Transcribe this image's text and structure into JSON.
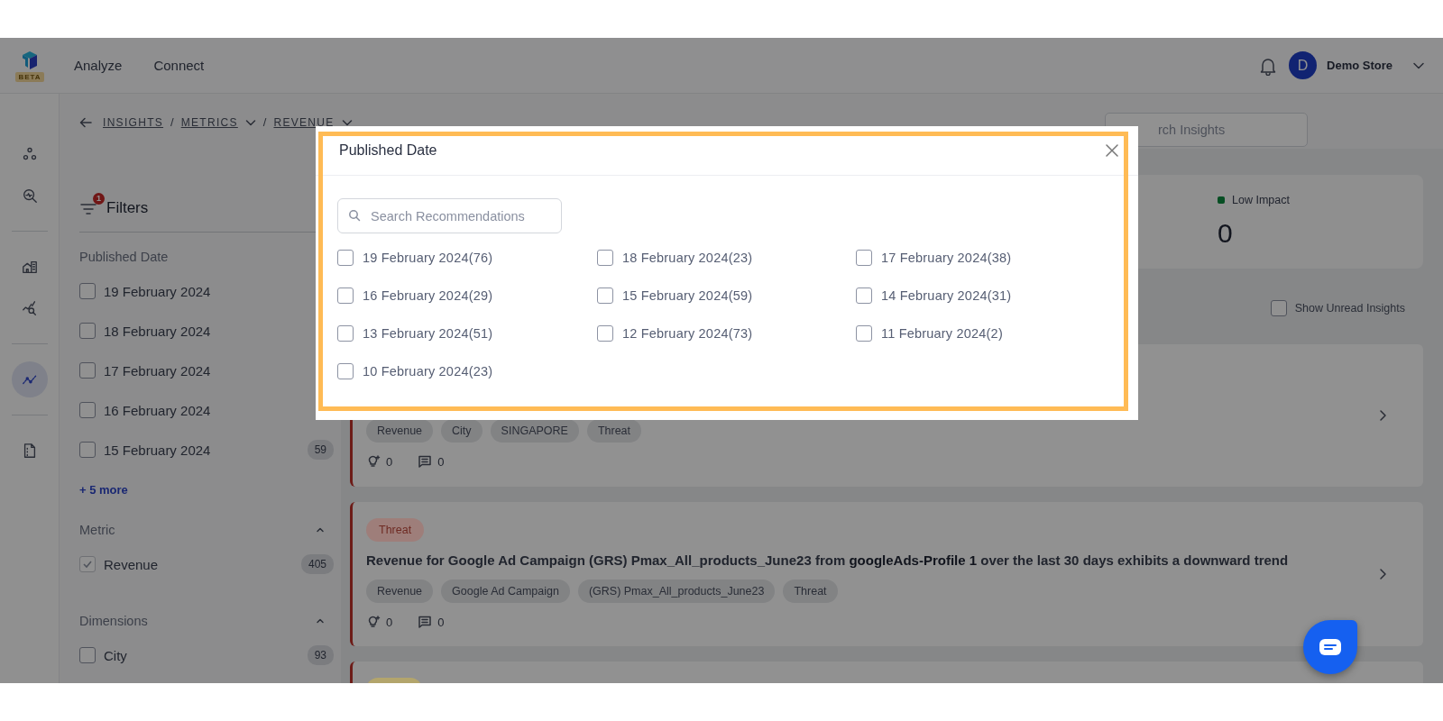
{
  "top_bar": {
    "logo_badge": "BETA",
    "nav": [
      {
        "label": "Analyze"
      },
      {
        "label": "Connect"
      }
    ],
    "avatar_letter": "D",
    "account": "Demo Store"
  },
  "rail": [
    {
      "kind": "nodes",
      "selected": false
    },
    {
      "kind": "magnifier",
      "selected": false
    },
    {
      "kind": "divider"
    },
    {
      "kind": "building",
      "selected": false
    },
    {
      "kind": "chart-search",
      "selected": false
    },
    {
      "kind": "divider"
    },
    {
      "kind": "trend",
      "selected": true
    },
    {
      "kind": "divider"
    },
    {
      "kind": "document",
      "selected": false
    }
  ],
  "breadcrumb": [
    {
      "kind": "link",
      "label": "INSIGHTS",
      "dropdown": false
    },
    {
      "kind": "separator",
      "label": "/"
    },
    {
      "kind": "link",
      "label": "METRICS",
      "dropdown": true
    },
    {
      "kind": "separator",
      "label": "/"
    },
    {
      "kind": "link",
      "label": "REVENUE",
      "dropdown": true
    }
  ],
  "search": {
    "placeholder": "rch Insights"
  },
  "filters": {
    "title": "Filters",
    "badge": "1",
    "sections": [
      {
        "title": "Published Date",
        "collapsible": false,
        "options": [
          {
            "label": "19 February 2024",
            "checked": false
          },
          {
            "label": "18 February 2024",
            "checked": false
          },
          {
            "label": "17 February 2024",
            "checked": false
          },
          {
            "label": "16 February 2024",
            "checked": false
          },
          {
            "label": "15 February 2024",
            "checked": false,
            "count": "59"
          }
        ],
        "more": "+ 5 more"
      },
      {
        "title": "Metric",
        "collapsible": true,
        "options": [
          {
            "label": "Revenue",
            "checked": true,
            "count": "405"
          }
        ]
      },
      {
        "title": "Dimensions",
        "collapsible": true,
        "options": [
          {
            "label": "City",
            "checked": false,
            "count": "93"
          }
        ]
      }
    ]
  },
  "impact": {
    "label": "Low Impact",
    "value": "0"
  },
  "unread_toggle": {
    "label": "Show Unread Insights",
    "checked": false
  },
  "insights": [
    {
      "tags": [
        "Revenue",
        "City",
        "SINGAPORE",
        "Threat"
      ],
      "ideas": "0",
      "comments": "0"
    },
    {
      "status": {
        "label": "Threat",
        "color": "#9e7e7a"
      },
      "title": "Revenue for Google Ad Campaign (GRS) Pmax_All_products_June23 from **googleAds-Profile 1** over the last 30 days exhibits a downward trend",
      "tags": [
        "Revenue",
        "Google Ad Campaign",
        "(GRS) Pmax_All_products_June23",
        "Threat"
      ],
      "ideas": "0",
      "comments": "0"
    },
    {
      "status": {
        "color": "#b3a56c"
      }
    }
  ],
  "modal": {
    "title": "Published Date",
    "search": {
      "placeholder": "Search Recommendations"
    },
    "options": [
      {
        "label": "19 February 2024(76)",
        "checked": false
      },
      {
        "label": "18 February 2024(23)",
        "checked": false
      },
      {
        "label": "17 February 2024(38)",
        "checked": false
      },
      {
        "label": "16 February 2024(29)",
        "checked": false
      },
      {
        "label": "15 February 2024(59)",
        "checked": false
      },
      {
        "label": "14 February 2024(31)",
        "checked": false
      },
      {
        "label": "13 February 2024(51)",
        "checked": false
      },
      {
        "label": "12 February 2024(73)",
        "checked": false
      },
      {
        "label": "11 February 2024(2)",
        "checked": false
      },
      {
        "label": "10 February 2024(23)",
        "checked": false
      }
    ]
  }
}
